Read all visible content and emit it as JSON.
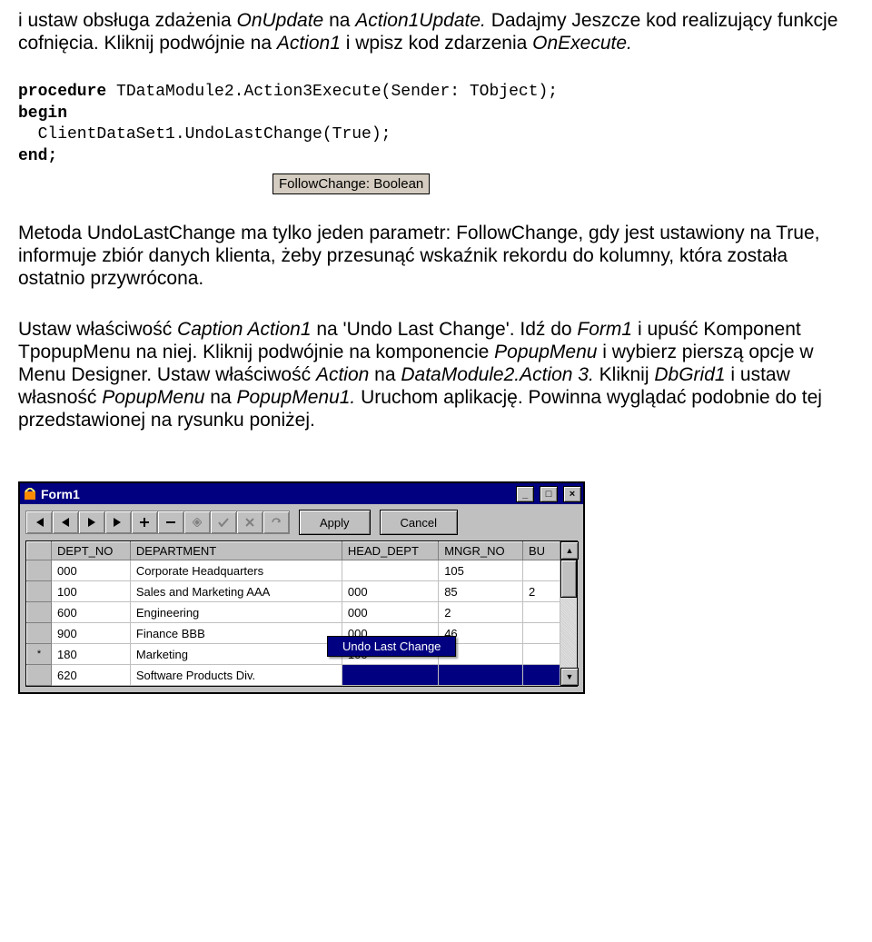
{
  "para1": {
    "t1": "i ustaw obsługa zdażenia ",
    "i1": "OnUpdate",
    "t2": " na ",
    "i2": "Action1Update.",
    "t3": " Dadajmy Jeszcze kod realizujący funkcje cofnięcia. Kliknij podwójnie na ",
    "i3": "Action1",
    "t4": " i wpisz kod zdarzenia ",
    "i4": "OnExecute."
  },
  "code": {
    "l1a": "procedure",
    "l1b": " TDataModule2.Action3Execute(Sender: TObject);",
    "l2": "begin",
    "l3": "  ClientDataSet1.UndoLastChange(True);",
    "l4": "end;"
  },
  "hint": "FollowChange: Boolean",
  "para2": {
    "t1": "Metoda UndoLastChange ma tylko jeden parametr: FollowChange, gdy jest ustawiony na True, informuje zbiór danych klienta, żeby przesunąć wskaźnik rekordu do kolumny, która została ostatnio przywrócona."
  },
  "para3": {
    "t1": "Ustaw właściwość ",
    "i1": "Caption Action1",
    "t2": " na 'Undo Last Change'. Idź do ",
    "i2": "Form1",
    "t3": " i upuść Komponent TpopupMenu na niej. Kliknij podwójnie na komponencie ",
    "i3": "PopupMenu",
    "t4": " i wybierz pierszą opcje w Menu Designer. Ustaw właściwość ",
    "i4": "Action",
    "t5": " na ",
    "i5": "DataModule2.Action 3.",
    "t6": " Kliknij ",
    "i6": "DbGrid1",
    "t7": " i ustaw własność ",
    "i7": "PopupMenu",
    "t8": " na ",
    "i8": "PopupMenu1.",
    "t9": " Uruchom aplikację. Powinna wyglądać podobnie do tej przedstawionej na rysunku poniżej."
  },
  "form": {
    "title": "Form1",
    "apply": "Apply",
    "cancel": "Cancel",
    "headers": [
      "DEPT_NO",
      "DEPARTMENT",
      "HEAD_DEPT",
      "MNGR_NO",
      "BU"
    ],
    "rows": [
      {
        "ind": "",
        "c": [
          "000",
          "Corporate Headquarters",
          "",
          "105",
          ""
        ]
      },
      {
        "ind": "",
        "c": [
          "100",
          "Sales and Marketing AAA",
          "000",
          "85",
          "2"
        ]
      },
      {
        "ind": "",
        "c": [
          "600",
          "Engineering",
          "000",
          "2",
          ""
        ]
      },
      {
        "ind": "",
        "c": [
          "900",
          "Finance BBB",
          "000",
          "46",
          ""
        ]
      },
      {
        "ind": "*",
        "c": [
          "180",
          "Marketing",
          "100",
          "",
          ""
        ]
      },
      {
        "ind": "",
        "c": [
          "620",
          "Software Products Div.",
          "",
          "",
          ""
        ]
      }
    ],
    "context_item": "Undo Last Change"
  }
}
